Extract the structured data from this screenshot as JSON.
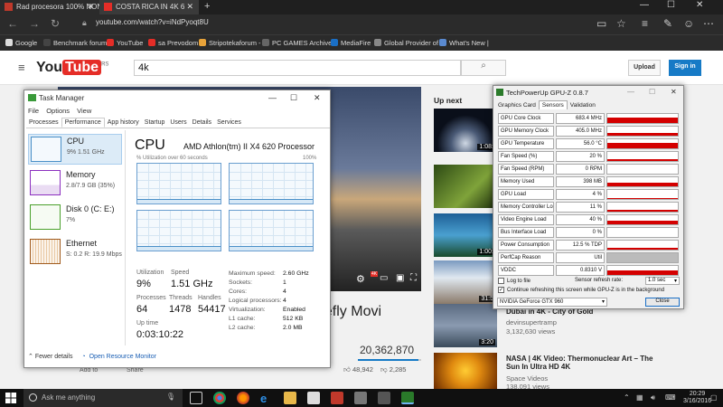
{
  "browser": {
    "tabs": [
      {
        "label": "Rad procesora 100% NON S"
      },
      {
        "label": "COSTA RICA IN 4K 6"
      }
    ],
    "new_tab": "+",
    "url": "youtube.com/watch?v=iNdPyoqt8U",
    "favorites": [
      "Google",
      "Benchmark forum",
      "YouTube",
      "sa Prevodom",
      "Stripotekaforum -",
      "PC GAMES Archives",
      "MediaFire",
      "Global Provider of",
      "What's New |"
    ]
  },
  "youtube": {
    "logo_you": "You",
    "logo_tube": "Tube",
    "logo_region": "RS",
    "search_value": "4k",
    "upload": "Upload",
    "signin": "Sign in",
    "video_title_fragment": "eefly Movi",
    "views": "20,362,870",
    "likes": "48,942",
    "dislikes": "2,285",
    "add_to": "Add to",
    "share": "Share",
    "up_next": "Up next",
    "sidebar": [
      {
        "duration": "1:08:",
        "title": "",
        "meta": ""
      },
      {
        "duration": "",
        "title": "",
        "meta": ""
      },
      {
        "duration": "1:00:",
        "title": "",
        "meta": ""
      },
      {
        "duration": "31:5",
        "title": "",
        "meta": ""
      },
      {
        "duration": "3:20",
        "title": "Dubai in 4K - City of Gold",
        "meta1": "devinsupertramp",
        "meta2": "3,132,630 views"
      },
      {
        "duration": "",
        "title": "NASA | 4K Video: Thermonuclear Art – The Sun In Ultra HD 4K",
        "meta1": "Space Videos",
        "meta2": "138,091 views"
      }
    ]
  },
  "taskmanager": {
    "title": "Task Manager",
    "menu": [
      "File",
      "Options",
      "View"
    ],
    "tabs": [
      "Processes",
      "Performance",
      "App history",
      "Startup",
      "Users",
      "Details",
      "Services"
    ],
    "resources": [
      {
        "name": "CPU",
        "value": "9% 1.51 GHz",
        "color": "#4a90c8"
      },
      {
        "name": "Memory",
        "value": "2.8/7.9 GB (35%)",
        "color": "#8b2fbf"
      },
      {
        "name": "Disk 0 (C: E:)",
        "value": "7%",
        "color": "#4aa02c"
      },
      {
        "name": "Ethernet",
        "value": "S: 0.2 R: 19.9 Mbps",
        "color": "#a05a1c"
      }
    ],
    "header": "CPU",
    "model": "AMD Athlon(tm) II X4 620 Processor",
    "util_caption": "% Utilization over 60 seconds",
    "pct100": "100%",
    "utilization_label": "Utilization",
    "utilization": "9%",
    "speed_label": "Speed",
    "speed": "1.51 GHz",
    "processes_label": "Processes",
    "processes": "64",
    "threads_label": "Threads",
    "threads": "1478",
    "handles_label": "Handles",
    "handles": "54417",
    "uptime_label": "Up time",
    "uptime": "0:03:10:22",
    "specs": [
      {
        "k": "Maximum speed:",
        "v": "2.60 GHz"
      },
      {
        "k": "Sockets:",
        "v": "1"
      },
      {
        "k": "Cores:",
        "v": "4"
      },
      {
        "k": "Logical processors:",
        "v": "4"
      },
      {
        "k": "Virtualization:",
        "v": "Enabled"
      },
      {
        "k": "L1 cache:",
        "v": "512 KB"
      },
      {
        "k": "L2 cache:",
        "v": "2.0 MB"
      }
    ],
    "fewer_details": "Fewer details",
    "resource_monitor": "Open Resource Monitor"
  },
  "gpuz": {
    "title": "TechPowerUp GPU-Z 0.8.7",
    "tabs": [
      "Graphics Card",
      "Sensors",
      "Validation"
    ],
    "sensors": [
      {
        "label": "GPU Core Clock",
        "value": "683.4 MHz",
        "level": 0.6
      },
      {
        "label": "GPU Memory Clock",
        "value": "405.0 MHz",
        "level": 0.3
      },
      {
        "label": "GPU Temperature",
        "value": "56.0 °C",
        "level": 0.55
      },
      {
        "label": "Fan Speed (%)",
        "value": "20 %",
        "level": 0.2
      },
      {
        "label": "Fan Speed (RPM)",
        "value": "0 RPM",
        "level": 0.0
      },
      {
        "label": "Memory Used",
        "value": "398 MB",
        "level": 0.4
      },
      {
        "label": "GPU Load",
        "value": "4 %",
        "level": 0.1
      },
      {
        "label": "Memory Controller Load",
        "value": "11 %",
        "level": 0.15
      },
      {
        "label": "Video Engine Load",
        "value": "40 %",
        "level": 0.35
      },
      {
        "label": "Bus Interface Load",
        "value": "0 %",
        "level": 0.0
      },
      {
        "label": "Power Consumption",
        "value": "12.5 % TDP",
        "level": 0.2
      },
      {
        "label": "PerfCap Reason",
        "value": "Util",
        "level": -1
      },
      {
        "label": "VDDC",
        "value": "0.8310 V",
        "level": 0.5
      }
    ],
    "log_to_file": "Log to file",
    "refresh_label": "Sensor refresh rate:",
    "refresh_value": "1.0 sec",
    "continue_label": "Continue refreshing this screen while GPU-Z is in the background",
    "gpu_name": "NVIDIA GeForce GTX 960",
    "close": "Close"
  },
  "taskbar": {
    "search": "Ask me anything",
    "time": "20:29",
    "date": "3/16/2016"
  },
  "colors": {
    "youtube_red": "#e52d27",
    "signin_blue": "#167ac6",
    "gpuz_red": "#d40000",
    "cpu_blue": "#4a90c8"
  }
}
